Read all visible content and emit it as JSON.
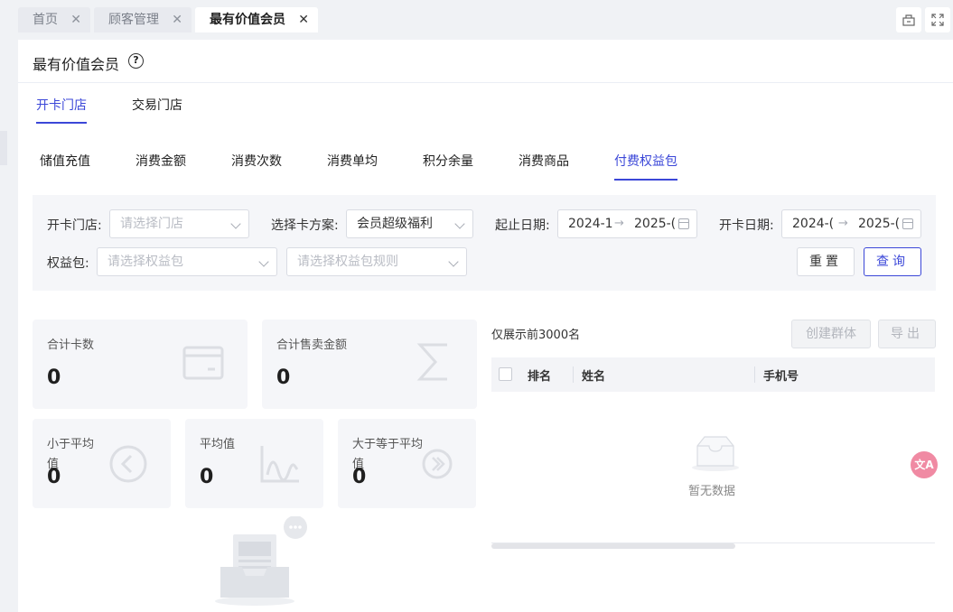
{
  "tabs": [
    {
      "label": "首页",
      "close": "✕"
    },
    {
      "label": "顾客管理",
      "close": "✕"
    },
    {
      "label": "最有价值会员",
      "close": "✕"
    }
  ],
  "toolbar": {
    "layout_icon": "sitemap-icon",
    "fullscreen_icon": "fullscreen-icon"
  },
  "page": {
    "title": "最有价值会员",
    "help": "?"
  },
  "store_tabs": [
    "开卡门店",
    "交易门店"
  ],
  "metric_tabs": [
    "储值充值",
    "消费金额",
    "消费次数",
    "消费单均",
    "积分余量",
    "消费商品",
    "付费权益包"
  ],
  "filters": {
    "store_label": "开卡门店:",
    "store_placeholder": "请选择门店",
    "plan_label": "选择卡方案:",
    "plan_value": "会员超级福利",
    "period_label": "起止日期:",
    "period_start": "2024-1",
    "period_end": "2025-(",
    "open_label": "开卡日期:",
    "open_start": "2024-(",
    "open_end": "2025-(",
    "range_arrow": "→",
    "package_label": "权益包:",
    "package_placeholder": "请选择权益包",
    "rule_placeholder": "请选择权益包规则",
    "reset": "重置",
    "query": "查询"
  },
  "stats": {
    "total_cards_label": "合计卡数",
    "total_cards_value": "0",
    "total_sales_label": "合计售卖金额",
    "total_sales_value": "0",
    "below_avg_label": "小于平均值",
    "below_avg_value": "0",
    "avg_label": "平均值",
    "avg_value": "0",
    "above_avg_label": "大于等于平均值",
    "above_avg_value": "0"
  },
  "table": {
    "note": "仅展示前3000名",
    "create_group": "创建群体",
    "export": "导出",
    "columns": [
      "排名",
      "姓名",
      "手机号"
    ],
    "empty": "暂无数据"
  },
  "translate_label": "文A",
  "colors": {
    "accent": "#3b47d8",
    "card_bg": "#f5f6f9",
    "page_bg": "#f0f2f5"
  }
}
